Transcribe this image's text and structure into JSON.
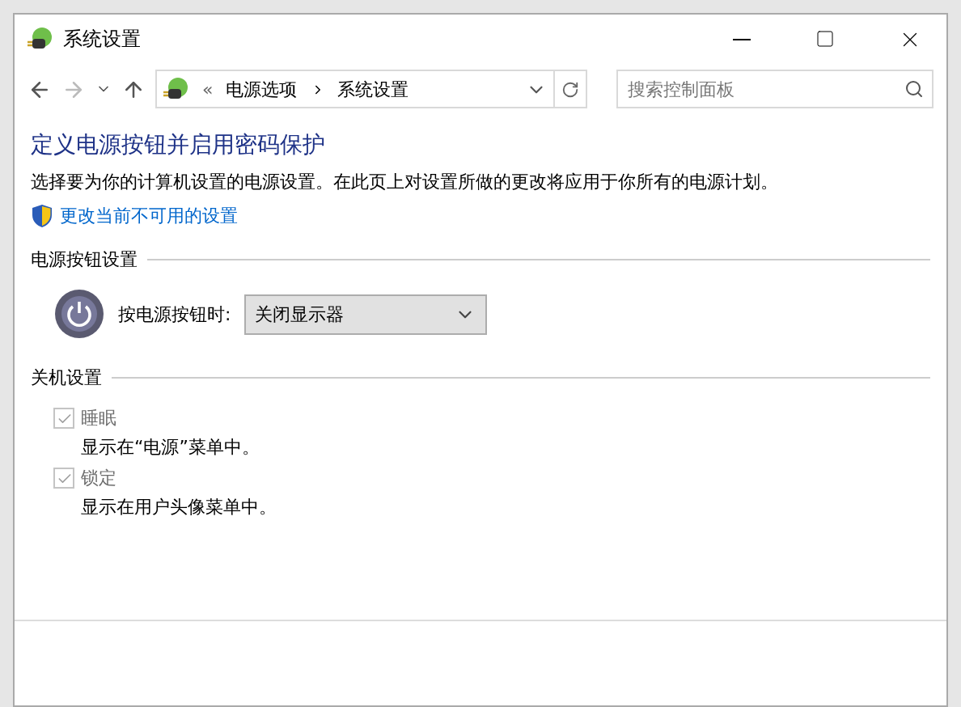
{
  "window": {
    "title": "系统设置"
  },
  "address_bar": {
    "path": [
      {
        "label": "电源选项"
      },
      {
        "label": "系统设置"
      }
    ],
    "overflow": "«"
  },
  "search": {
    "placeholder": "搜索控制面板"
  },
  "heading": "定义电源按钮并启用密码保护",
  "description": "选择要为你的计算机设置的电源设置。在此页上对设置所做的更改将应用于你所有的电源计划。",
  "admin_link": "更改当前不可用的设置",
  "power_button_section": {
    "title": "电源按钮设置",
    "label": "按电源按钮时:",
    "value": "关闭显示器"
  },
  "shutdown_section": {
    "title": "关机设置",
    "options": [
      {
        "label": "睡眠",
        "description": "显示在“电源”菜单中。",
        "checked": true,
        "disabled": true
      },
      {
        "label": "锁定",
        "description": "显示在用户头像菜单中。",
        "checked": true,
        "disabled": true
      }
    ]
  }
}
